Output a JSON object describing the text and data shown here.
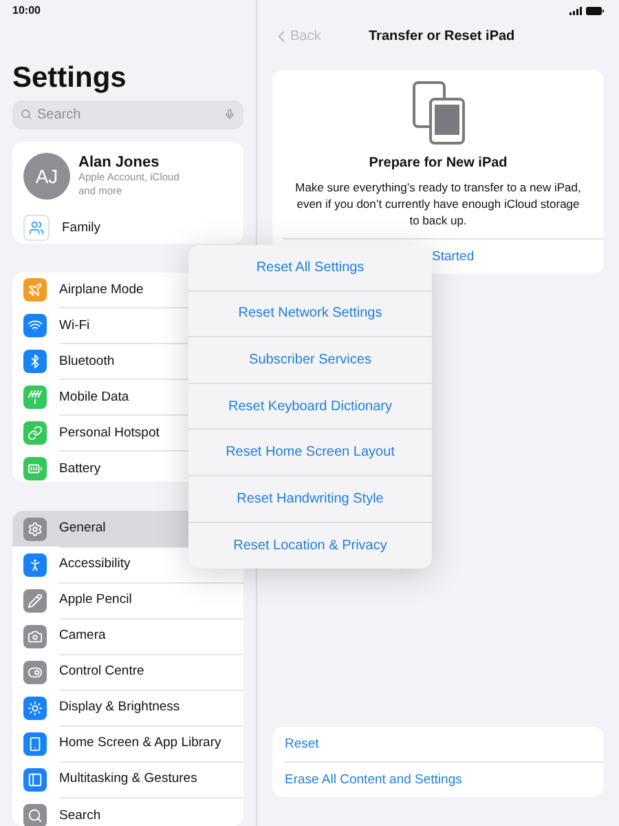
{
  "status_bar": {
    "time": "10:00"
  },
  "sidebar": {
    "title": "Settings",
    "search": {
      "placeholder": "Search"
    },
    "account": {
      "initials": "AJ",
      "name": "Alan Jones",
      "subtitle": "Apple Account, iCloud and more",
      "family": "Family"
    },
    "groups": [
      [
        {
          "label": "Airplane Mode",
          "color": "#f59a23",
          "selected": false
        },
        {
          "label": "Wi-Fi",
          "color": "#1a82f7",
          "selected": false
        },
        {
          "label": "Bluetooth",
          "color": "#1a82f7",
          "selected": false
        },
        {
          "label": "Mobile Data",
          "color": "#34c759",
          "selected": false
        },
        {
          "label": "Personal Hotspot",
          "color": "#34c759",
          "selected": false
        },
        {
          "label": "Battery",
          "color": "#34c759",
          "selected": false
        }
      ],
      [
        {
          "label": "General",
          "color": "#8e8e93",
          "selected": true
        },
        {
          "label": "Accessibility",
          "color": "#1a82f7",
          "selected": false
        },
        {
          "label": "Apple Pencil",
          "color": "#8e8e93",
          "selected": false
        },
        {
          "label": "Camera",
          "color": "#8e8e93",
          "selected": false
        },
        {
          "label": "Control Centre",
          "color": "#8e8e93",
          "selected": false
        },
        {
          "label": "Display & Brightness",
          "color": "#1a82f7",
          "selected": false
        },
        {
          "label": "Home Screen & App Library",
          "color": "#1a82f7",
          "selected": false
        },
        {
          "label": "Multitasking & Gestures",
          "color": "#1a82f7",
          "selected": false
        },
        {
          "label": "Search",
          "color": "#8e8e93",
          "selected": false
        }
      ]
    ]
  },
  "detail": {
    "back": "Back",
    "title": "Transfer or Reset iPad",
    "prepare": {
      "title": "Prepare for New iPad",
      "text": "Make sure everything’s ready to transfer to a new iPad, even if you don’t currently have enough iCloud storage to back up.",
      "link": "Started"
    },
    "actions": [
      "Reset",
      "Erase All Content and Settings"
    ]
  },
  "reset_menu": [
    "Reset All Settings",
    "Reset Network Settings",
    "Subscriber Services",
    "Reset Keyboard Dictionary",
    "Reset Home Screen Layout",
    "Reset Handwriting Style",
    "Reset Location & Privacy"
  ]
}
